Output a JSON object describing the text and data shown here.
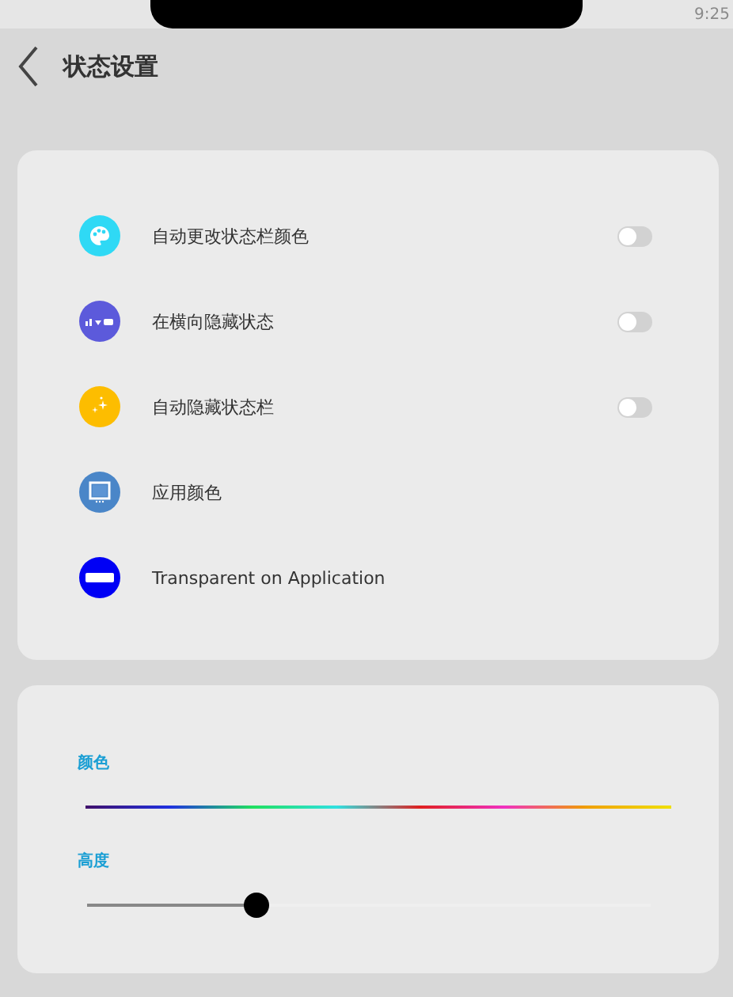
{
  "status_bar": {
    "time": "9:25"
  },
  "header": {
    "title": "状态设置"
  },
  "settings": [
    {
      "label": "自动更改状态栏颜色",
      "color": "#2fd9f5",
      "kind": "toggle",
      "on": false
    },
    {
      "label": "在横向隐藏状态",
      "color": "#5c5adb",
      "kind": "toggle",
      "on": false
    },
    {
      "label": "自动隐藏状态栏",
      "color": "#fdbd00",
      "kind": "toggle",
      "on": false
    },
    {
      "label": "应用颜色",
      "color": "#4a86c8",
      "kind": "plain"
    },
    {
      "label": "Transparent on Application",
      "color": "#0000f5",
      "kind": "plain"
    }
  ],
  "sliders": [
    {
      "label": "颜色",
      "kind": "spectrum"
    },
    {
      "label": "高度",
      "kind": "level",
      "level": 0.3
    }
  ]
}
